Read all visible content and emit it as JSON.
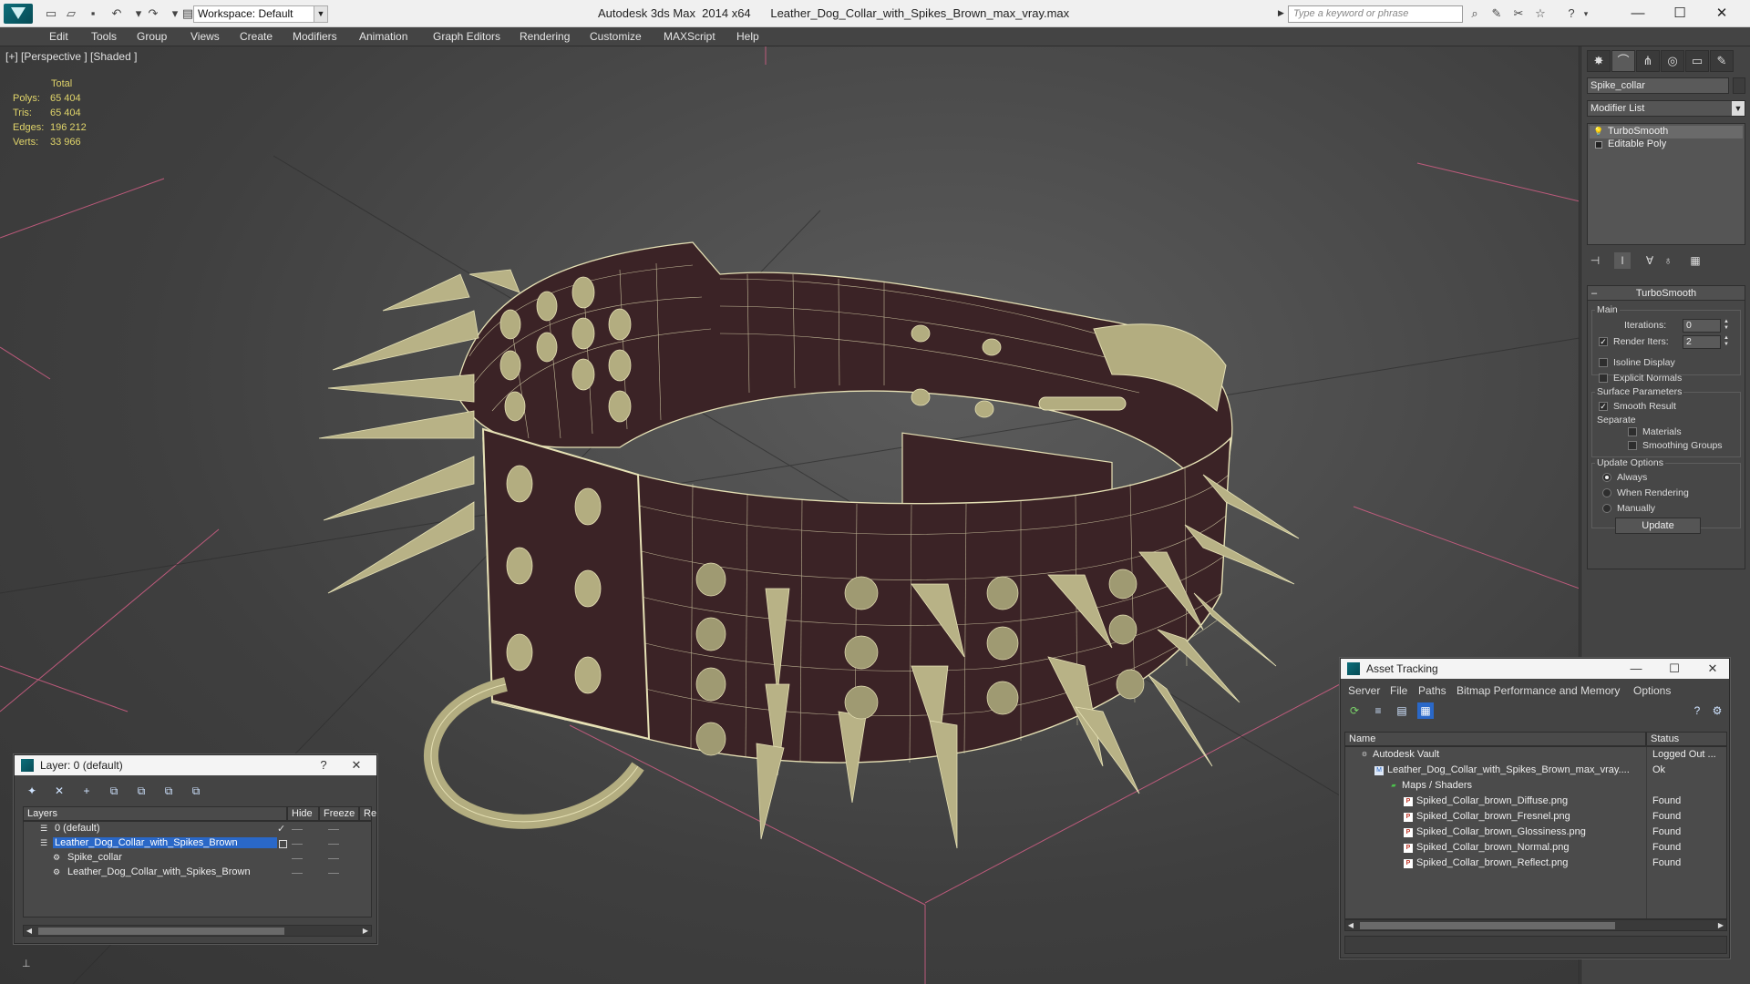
{
  "app": {
    "title": "Autodesk 3ds Max  2014 x64",
    "filename": "Leather_Dog_Collar_with_Spikes_Brown_max_vray.max",
    "workspace": "Workspace: Default",
    "search_placeholder": "Type a keyword or phrase"
  },
  "menu": [
    "Edit",
    "Tools",
    "Group",
    "Views",
    "Create",
    "Modifiers",
    "Animation",
    "Graph Editors",
    "Rendering",
    "Customize",
    "MAXScript",
    "Help"
  ],
  "viewport": {
    "label": "[+] [Perspective ] [Shaded ]",
    "stats": {
      "header": "Total",
      "rows": [
        {
          "label": "Polys:",
          "value": "65 404"
        },
        {
          "label": "Tris:",
          "value": "65 404"
        },
        {
          "label": "Edges:",
          "value": "196 212"
        },
        {
          "label": "Verts:",
          "value": "33 966"
        }
      ]
    }
  },
  "command_panel": {
    "object_name": "Spike_collar",
    "modifier_list": "Modifier List",
    "stack": [
      "TurboSmooth",
      "Editable Poly"
    ],
    "rollout": {
      "title": "TurboSmooth",
      "main_group": "Main",
      "iterations_label": "Iterations:",
      "iterations_value": "0",
      "render_iters_label": "Render Iters:",
      "render_iters_value": "2",
      "render_iters_checked": true,
      "isoline_label": "Isoline Display",
      "explicit_normals_label": "Explicit Normals",
      "surface_group": "Surface Parameters",
      "smooth_result_label": "Smooth Result",
      "separate_label": "Separate",
      "materials_label": "Materials",
      "smoothing_groups_label": "Smoothing Groups",
      "update_group": "Update Options",
      "always_label": "Always",
      "when_rendering_label": "When Rendering",
      "manually_label": "Manually",
      "update_button": "Update"
    }
  },
  "layer_dialog": {
    "title": "Layer: 0 (default)",
    "help": "?",
    "columns": [
      "Layers",
      "Hide",
      "Freeze",
      "Re"
    ],
    "rows": [
      {
        "name": "0 (default)",
        "indent": 1
      },
      {
        "name": "Leather_Dog_Collar_with_Spikes_Brown",
        "indent": 1,
        "selected": true
      },
      {
        "name": "Spike_collar",
        "indent": 2
      },
      {
        "name": "Leather_Dog_Collar_with_Spikes_Brown",
        "indent": 2
      }
    ]
  },
  "asset_tracking": {
    "title": "Asset Tracking",
    "menu": [
      "Server",
      "File",
      "Paths",
      "Bitmap Performance and Memory",
      "Options"
    ],
    "columns": [
      "Name",
      "Status"
    ],
    "rows": [
      {
        "name": "Autodesk Vault",
        "status": "Logged Out ...",
        "indent": 0,
        "icon": "vault"
      },
      {
        "name": "Leather_Dog_Collar_with_Spikes_Brown_max_vray....",
        "status": "Ok",
        "indent": 1,
        "icon": "max"
      },
      {
        "name": "Maps / Shaders",
        "status": "",
        "indent": 2,
        "icon": "maps"
      },
      {
        "name": "Spiked_Collar_brown_Diffuse.png",
        "status": "Found",
        "indent": 3,
        "icon": "png"
      },
      {
        "name": "Spiked_Collar_brown_Fresnel.png",
        "status": "Found",
        "indent": 3,
        "icon": "png"
      },
      {
        "name": "Spiked_Collar_brown_Glossiness.png",
        "status": "Found",
        "indent": 3,
        "icon": "png"
      },
      {
        "name": "Spiked_Collar_brown_Normal.png",
        "status": "Found",
        "indent": 3,
        "icon": "png"
      },
      {
        "name": "Spiked_Collar_brown_Reflect.png",
        "status": "Found",
        "indent": 3,
        "icon": "png"
      }
    ]
  },
  "colors": {
    "viewport_bg": "#474747",
    "wire": "#e6e1b5",
    "leather": "#3b2326",
    "grid_line": "#d35f86",
    "stats_text": "#e0d46a",
    "selection": "#2a68c8"
  }
}
